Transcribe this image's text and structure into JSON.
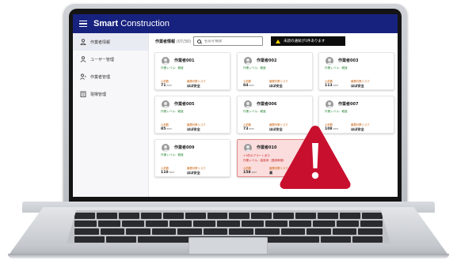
{
  "app": {
    "brand_bold": "Smart",
    "brand_rest": " Construction"
  },
  "sidebar": {
    "items": [
      {
        "label": "作業者情報",
        "icon": "worker-icon",
        "active": true
      },
      {
        "label": "ユーザー管理",
        "icon": "user-icon",
        "active": false
      },
      {
        "label": "作業者管理",
        "icon": "worker-manage-icon",
        "active": false
      },
      {
        "label": "現場管理",
        "icon": "building-icon",
        "active": false
      }
    ]
  },
  "toolbar": {
    "page_title": "作業者情報",
    "page_count": "(07/30)",
    "search_placeholder": "名前を検索",
    "alert_message": "未読の通知が1件あります"
  },
  "cards": [
    {
      "name": "作業者001",
      "level": "作業レベル：軽度",
      "hr_label": "心拍数",
      "hr": "71",
      "hr_unit": "BPM",
      "risk_label": "最悪対策リスク",
      "risk": "ほぼ安全"
    },
    {
      "name": "作業者002",
      "level": "作業レベル：軽度",
      "hr_label": "心拍数",
      "hr": "84",
      "hr_unit": "BPM",
      "risk_label": "最悪対策リスク",
      "risk": "ほぼ安全"
    },
    {
      "name": "作業者003",
      "level": "作業レベル：軽度",
      "hr_label": "心拍数",
      "hr": "113",
      "hr_unit": "BPM",
      "risk_label": "最悪対策リスク",
      "risk": "ほぼ安全"
    },
    {
      "name": "作業者005",
      "level": "作業レベル：軽度",
      "hr_label": "心拍数",
      "hr": "85",
      "hr_unit": "BPM",
      "risk_label": "最悪対策リスク",
      "risk": "ほぼ安全"
    },
    {
      "name": "作業者006",
      "level": "作業レベル：軽度",
      "hr_label": "心拍数",
      "hr": "73",
      "hr_unit": "BPM",
      "risk_label": "最悪対策リスク",
      "risk": "ほぼ安全"
    },
    {
      "name": "作業者007",
      "level": "作業レベル：軽度",
      "hr_label": "心拍数",
      "hr": "108",
      "hr_unit": "BPM",
      "risk_label": "最悪対策リスク",
      "risk": "ほぼ安全"
    },
    {
      "name": "作業者009",
      "level": "作業レベル：軽度",
      "hr_label": "心拍数",
      "hr": "110",
      "hr_unit": "BPM",
      "risk_label": "最悪対策リスク",
      "risk": "ほぼ安全"
    }
  ],
  "alert_card": {
    "name": "作業者010",
    "note": "+1件のアラートあり",
    "level": "作業レベル：高負荷（連続稼働）",
    "hr_label": "心拍数",
    "hr": "158",
    "hr_unit": "BPM",
    "risk_label": "最悪対策リスク",
    "risk": "高"
  },
  "colors": {
    "appbar": "#17227f",
    "alert_red": "#c8102e",
    "alert_card_bg": "#fbdddd",
    "level_green": "#2e8b3a"
  },
  "overlay": {
    "icon": "warning-icon"
  }
}
